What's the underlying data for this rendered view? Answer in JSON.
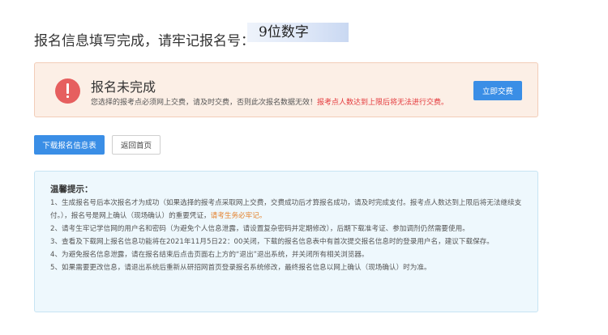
{
  "header": {
    "title": "报名信息填写完成，请牢记报名号：",
    "reg_number": "9位数字"
  },
  "alert": {
    "title": "报名未完成",
    "desc_prefix": "您选择的报考点必须网上交费，请及时交费，否则此次报名数据无效！",
    "desc_highlight": "报考点人数达到上限后将无法进行交费。",
    "icon": "exclamation-circle-icon",
    "pay_button": "立即交费"
  },
  "actions": {
    "download_label": "下载报名信息表",
    "home_label": "返回首页"
  },
  "tips": {
    "title": "温馨提示：",
    "item1_a": "1、生成报名号后本次报名才为成功（如果选择的报考点采取网上交费，交费成功后才算报名成功，请及时完成支付。报考点人数达到上限后将无法继续支付。），报名号是网上确认（现场确认）的重要凭证，",
    "item1_emph": "请考生务必牢记。",
    "item2": "2、请考生牢记学信网的用户名和密码（为避免个人信息泄露，请设置复杂密码并定期修改），后期下载准考证、参加调剂仍然需要使用。",
    "item3": "3、查看及下载网上报名信息功能将在2021年11月5日22：00关闭，下载的报名信息表中有首次提交报名信息时的登录用户名，建议下载保存。",
    "item4": "4、为避免报名信息泄露，请在报名结束后点击页面右上方的“退出”退出系统，并关闭所有相关浏览器。",
    "item5": "5、如果需要更改信息，请退出系统后重新从研招网首页登录报名系统修改，最终报名信息以网上确认（现场确认）时为准。"
  },
  "colors": {
    "primary": "#3a8ee6",
    "alert_bg": "#fcefe6",
    "alert_icon": "#e65f5f",
    "tips_bg": "#eef8fd",
    "emphasis": "#e4802a"
  }
}
